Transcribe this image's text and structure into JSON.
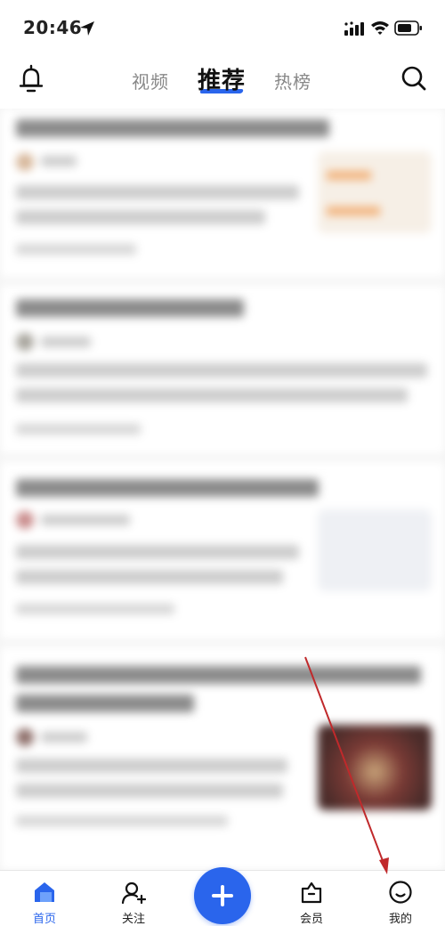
{
  "status_bar": {
    "time": "20:46"
  },
  "top_nav": {
    "tabs": [
      {
        "label": "视频"
      },
      {
        "label": "推荐",
        "active": true
      },
      {
        "label": "热榜"
      }
    ],
    "icons": {
      "left": "bell-icon",
      "right": "search-icon"
    }
  },
  "feed": {
    "blurred": true,
    "visible_card_count": 4
  },
  "bottom_tabs": [
    {
      "label": "首页",
      "icon": "home-icon",
      "active": true
    },
    {
      "label": "关注",
      "icon": "follow-icon"
    },
    {
      "label": "",
      "icon": "plus-icon"
    },
    {
      "label": "会员",
      "icon": "vip-icon"
    },
    {
      "label": "我的",
      "icon": "smiley-icon"
    }
  ],
  "colors": {
    "accent": "#2a65ec",
    "annotation_arrow": "#c0292b"
  }
}
